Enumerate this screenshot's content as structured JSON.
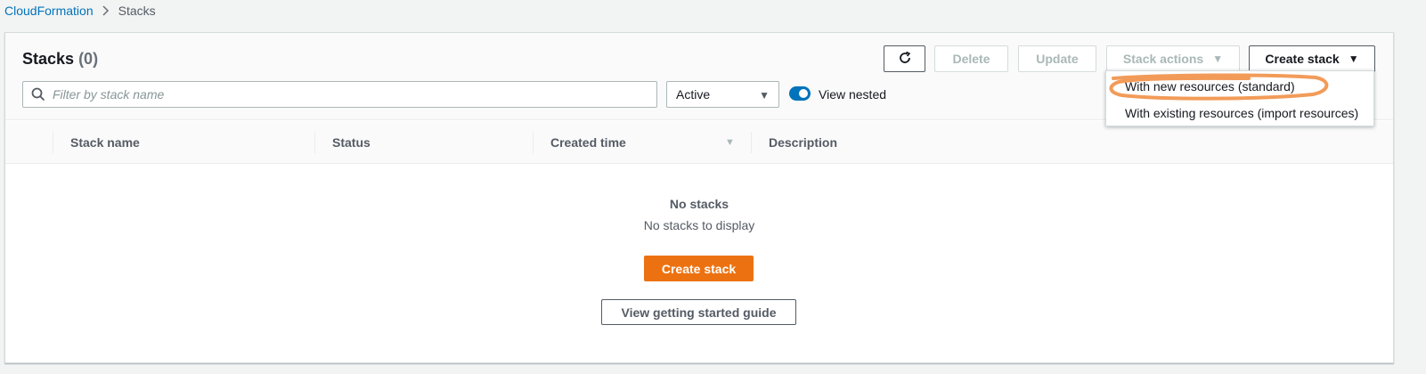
{
  "breadcrumb": {
    "parent": "CloudFormation",
    "current": "Stacks"
  },
  "header": {
    "title": "Stacks",
    "count": "(0)"
  },
  "toolbar": {
    "delete_label": "Delete",
    "update_label": "Update",
    "stack_actions_label": "Stack actions",
    "create_stack_label": "Create stack"
  },
  "filter": {
    "placeholder": "Filter by stack name",
    "status_selected": "Active",
    "view_nested_label": "View nested",
    "view_nested_on": true
  },
  "table": {
    "columns": [
      "Stack name",
      "Status",
      "Created time",
      "Description"
    ]
  },
  "empty_state": {
    "title": "No stacks",
    "description": "No stacks to display",
    "create_label": "Create stack",
    "guide_label": "View getting started guide"
  },
  "create_menu": {
    "items": [
      "With new resources (standard)",
      "With existing resources (import resources)"
    ]
  },
  "colors": {
    "link": "#0073bb",
    "primary": "#ec7211",
    "toggle_on": "#0073bb",
    "highlight_marker": "#f08a3c"
  }
}
